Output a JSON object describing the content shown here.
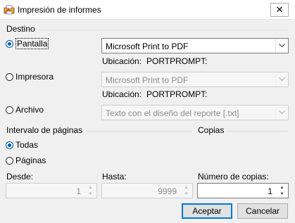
{
  "window": {
    "title": "Impresión de informes",
    "close_icon": "✕"
  },
  "destino": {
    "label": "Destino",
    "pantalla": {
      "label": "Pantalla",
      "selected": true,
      "printer": "Microsoft Print to PDF",
      "location_label": "Ubicación:",
      "location_value": "PORTPROMPT:"
    },
    "impresora": {
      "label": "Impresora",
      "selected": false,
      "printer": "Microsoft Print to PDF",
      "location_label": "Ubicación:",
      "location_value": "PORTPROMPT:"
    },
    "archivo": {
      "label": "Archivo",
      "selected": false,
      "format": "Texto con el diseño del reporte [.txt]"
    }
  },
  "intervalo": {
    "label": "Intervalo de páginas",
    "todas": {
      "label": "Todas",
      "selected": true
    },
    "paginas": {
      "label": "Páginas",
      "selected": false
    },
    "desde": {
      "label": "Desde:",
      "value": "1"
    },
    "hasta": {
      "label": "Hasta:",
      "value": "9999"
    }
  },
  "copias": {
    "label": "Copias",
    "numero": {
      "label": "Número de copias:",
      "value": "1"
    }
  },
  "buttons": {
    "accept": "Aceptar",
    "cancel": "Cancelar"
  }
}
